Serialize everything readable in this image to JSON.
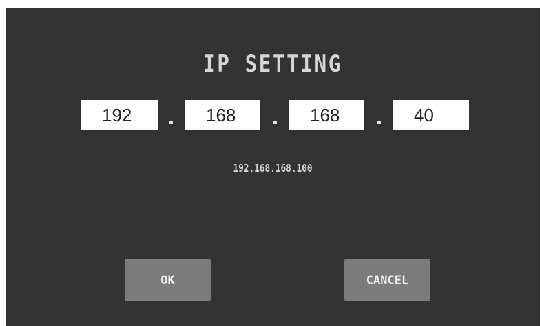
{
  "title": "IP SETTING",
  "ip_fields": [
    {
      "value": "192"
    },
    {
      "value": "168"
    },
    {
      "value": "168"
    },
    {
      "value": "40"
    }
  ],
  "separator": ".",
  "current_ip": "192.168.168.100",
  "buttons": {
    "ok_label": "OK",
    "cancel_label": "CANCEL"
  },
  "colors": {
    "background": "#333333",
    "button": "#7b7b7b",
    "text": "#d6d6d6",
    "field": "#ffffff"
  }
}
